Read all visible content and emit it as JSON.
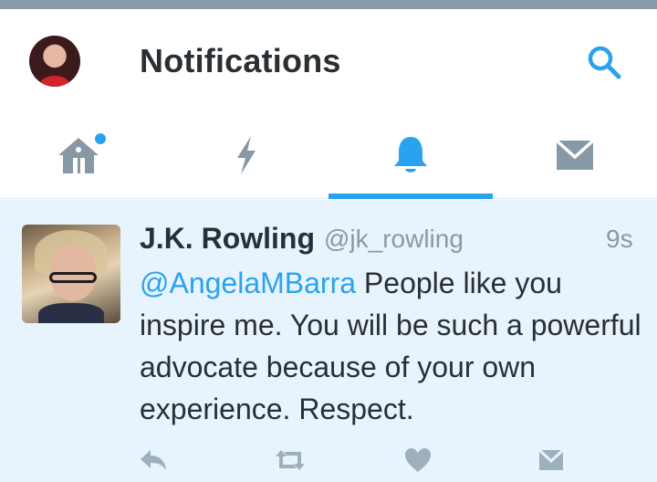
{
  "header": {
    "title": "Notifications"
  },
  "tabs": [
    {
      "id": "home",
      "icon": "home-icon",
      "selected": false,
      "badge": true
    },
    {
      "id": "moments",
      "icon": "lightning-icon",
      "selected": false,
      "badge": false
    },
    {
      "id": "notifications",
      "icon": "bell-icon",
      "selected": true,
      "badge": false
    },
    {
      "id": "messages",
      "icon": "envelope-icon",
      "selected": false,
      "badge": false
    }
  ],
  "tweet": {
    "name": "J.K. Rowling",
    "handle": "@jk_rowling",
    "time": "9s",
    "mention": "@AngelaMBarra",
    "text": " People like you inspire me. You will be such a powerful advocate because of your own experience. Respect."
  },
  "actions": [
    "reply-icon",
    "retweet-icon",
    "like-icon",
    "direct-message-icon"
  ],
  "colors": {
    "accent": "#2aa3ef",
    "icon_gray": "#8899a6",
    "text": "#292f33",
    "tweet_bg": "#e8f4fd"
  }
}
